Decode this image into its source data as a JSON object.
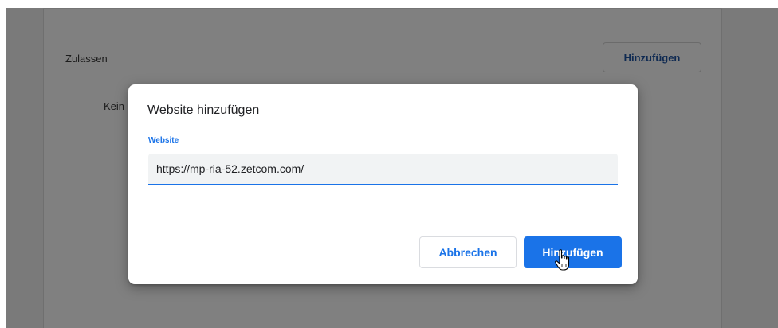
{
  "background": {
    "section_label": "Zulassen",
    "add_button_label": "Hinzufügen",
    "empty_text": "Kein"
  },
  "dialog": {
    "title": "Website hinzufügen",
    "field_label": "Website",
    "input_value": "https://mp-ria-52.zetcom.com/",
    "cancel_label": "Abbrechen",
    "confirm_label": "Hinzufügen"
  },
  "cursor": {
    "icon": "hand-pointer-icon"
  },
  "colors": {
    "accent": "#1a73e8",
    "overlay": "#808080",
    "input_bg": "#f1f3f4"
  }
}
